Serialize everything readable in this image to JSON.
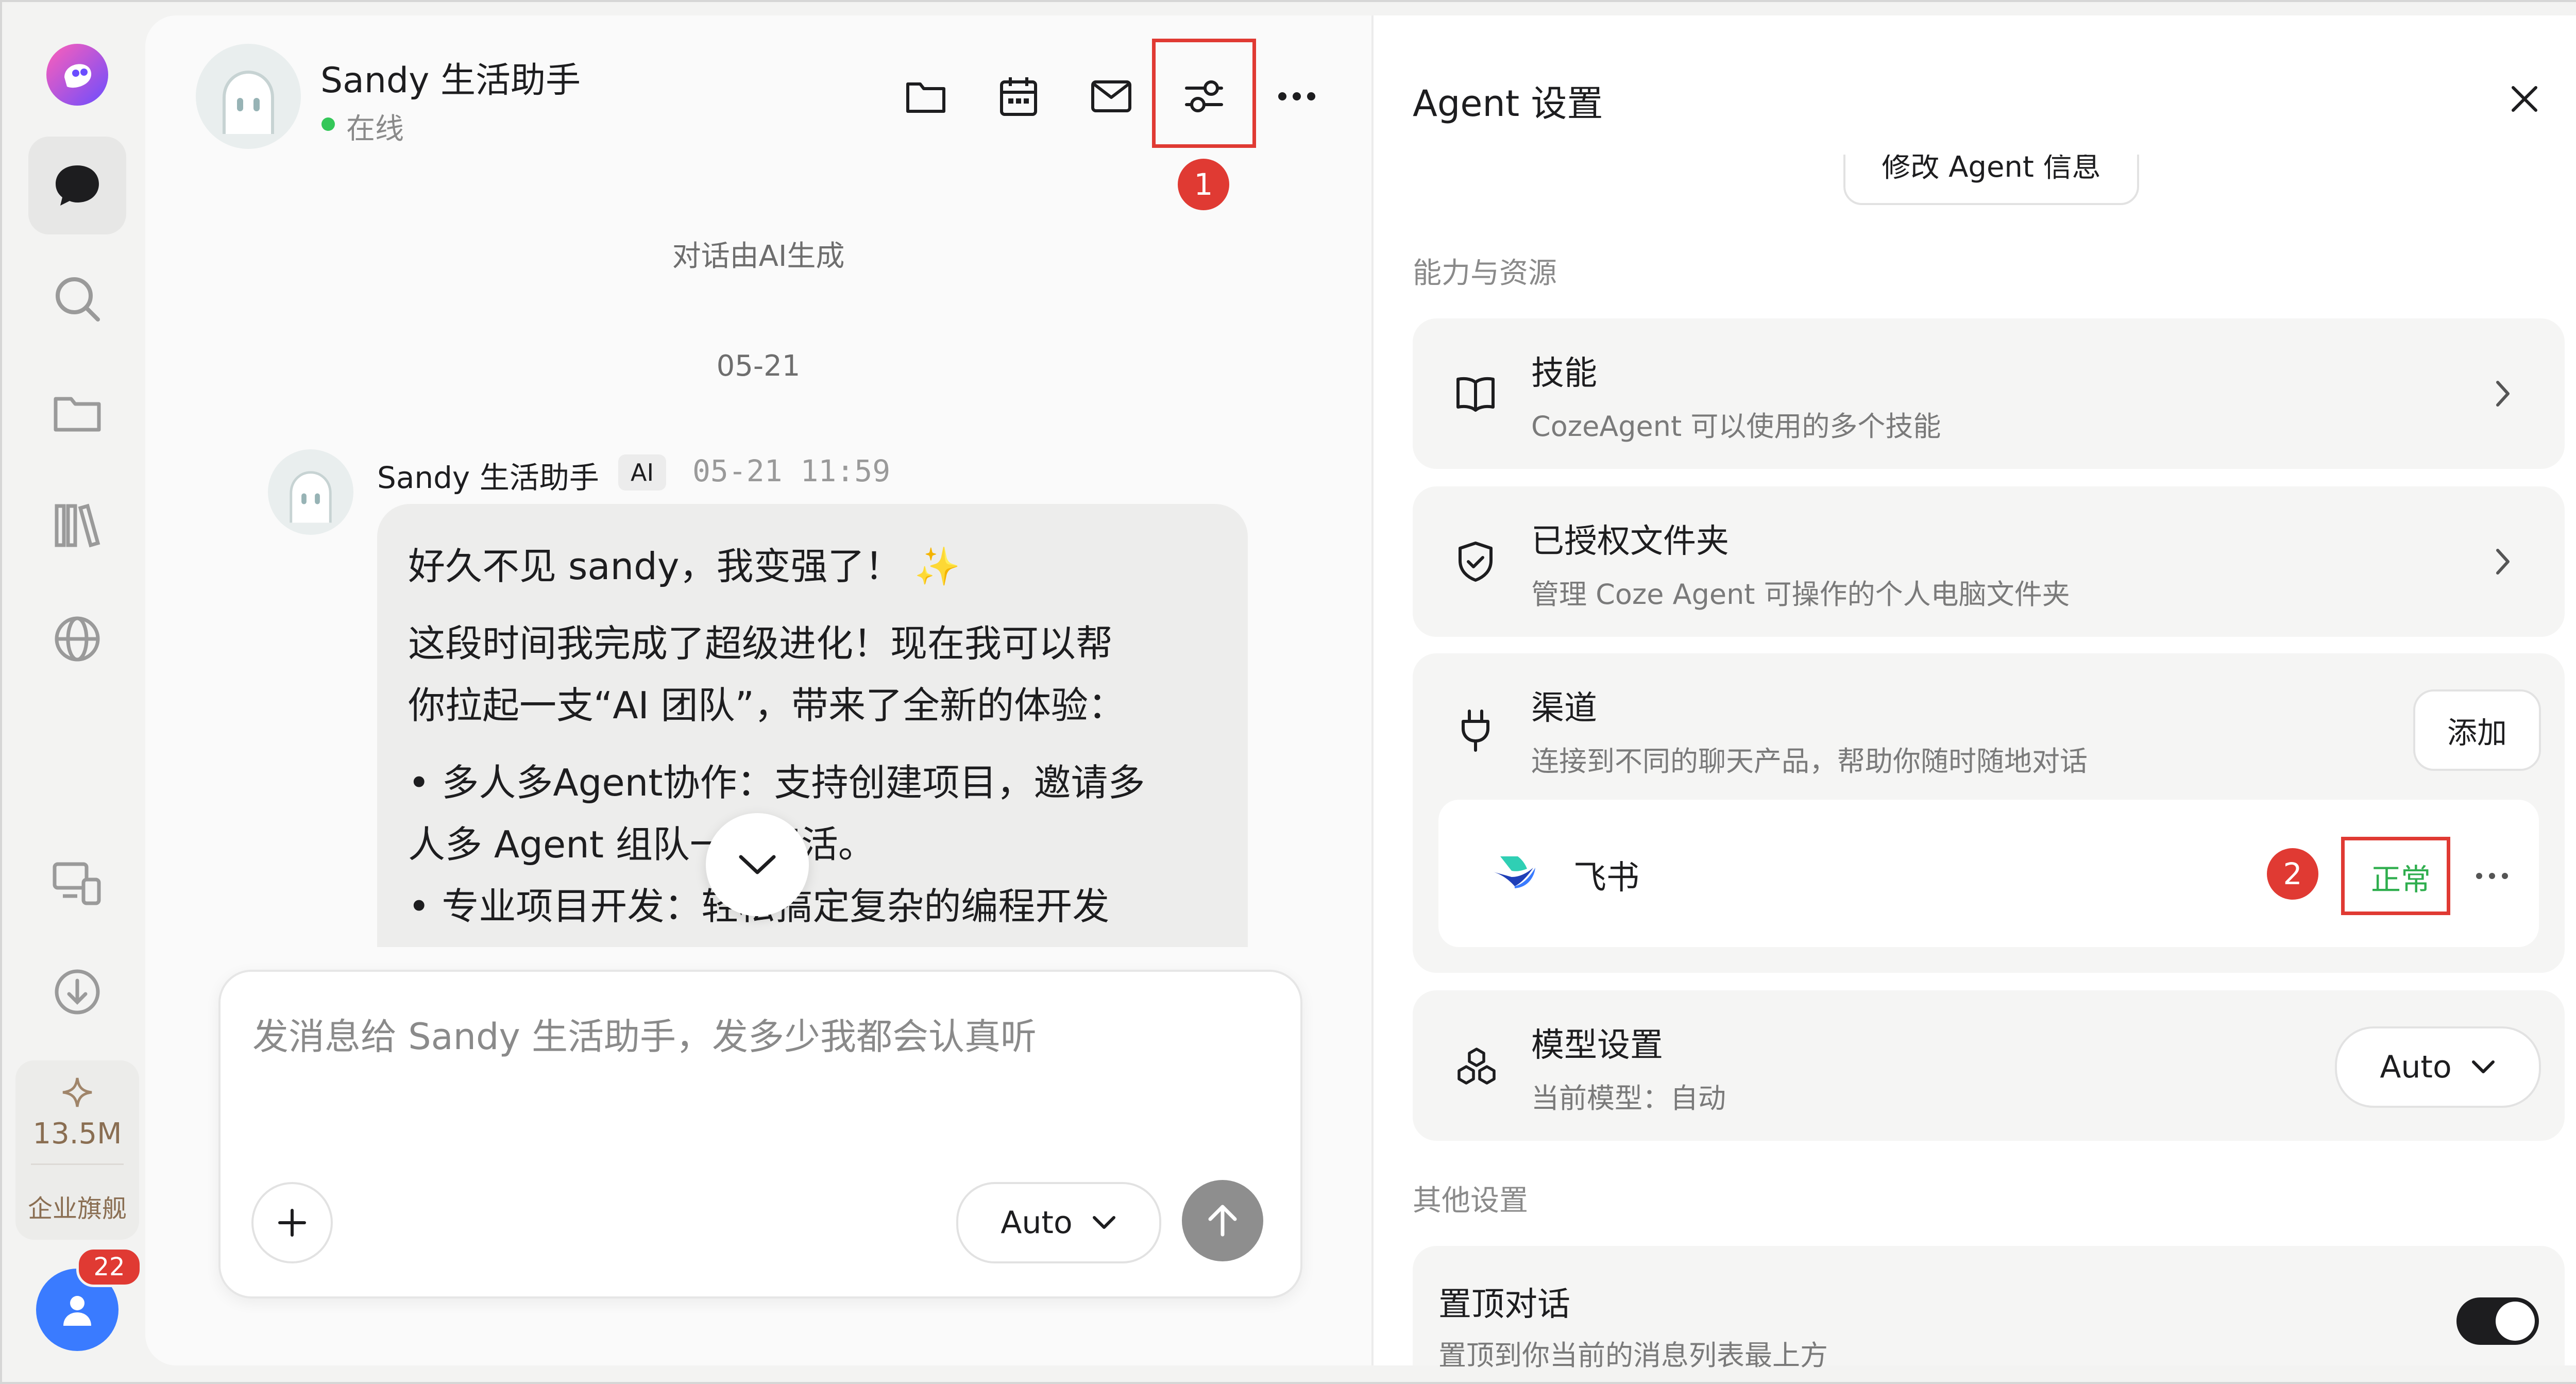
{
  "sidebar": {
    "credits": "13.5M",
    "plan": "企业旗舰",
    "badge": "22"
  },
  "chat": {
    "agent_name": "Sandy 生活助手",
    "status": "在线",
    "ai_notice": "对话由AI生成",
    "date_divider": "05-21",
    "message": {
      "sender": "Sandy 生活助手",
      "tag": "AI",
      "time": "05-21 11:59",
      "line1": "好久不见 sandy，我变强了！",
      "line2": "这段时间我完成了超级进化！现在我可以帮",
      "line3": "你拉起一支“AI 团队”，带来了全新的体验：",
      "line4": "• 多人多Agent协作：支持创建项目，邀请多",
      "line5": "人多 Agent 组队一起干活。",
      "line6": "• 专业项目开发：轻松搞定复杂的编程开发"
    },
    "input_placeholder": "发消息给 Sandy 生活助手，发多少我都会认真听",
    "model_select": "Auto",
    "step1": "1"
  },
  "panel": {
    "title": "Agent 设置",
    "edit_button": "修改 Agent 信息",
    "section_abilities": "能力与资源",
    "skills": {
      "title": "技能",
      "sub": "CozeAgent 可以使用的多个技能"
    },
    "folders": {
      "title": "已授权文件夹",
      "sub": "管理 Coze Agent 可操作的个人电脑文件夹"
    },
    "channels": {
      "title": "渠道",
      "sub": "连接到不同的聊天产品，帮助你随时随地对话",
      "add": "添加"
    },
    "feishu": {
      "name": "飞书",
      "status": "正常",
      "step2": "2"
    },
    "model": {
      "title": "模型设置",
      "sub": "当前模型：自动",
      "value": "Auto"
    },
    "section_other": "其他设置",
    "pin": {
      "title": "置顶对话",
      "sub": "置顶到你当前的消息列表最上方",
      "on": true
    }
  },
  "colors": {
    "accent_red": "#e03a33",
    "status_green": "#2fae4e",
    "online_green": "#34c759",
    "avatar_blue": "#3a7bff"
  }
}
